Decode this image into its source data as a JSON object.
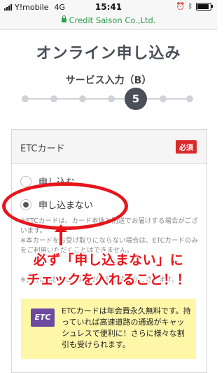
{
  "status_bar": {
    "carrier": "Y!mobile",
    "network": "4G",
    "time": "15:41",
    "battery_icon": "battery-icon",
    "bluetooth_icon": "bluetooth-icon"
  },
  "browser": {
    "url": "Credit Saison Co.,Ltd."
  },
  "page": {
    "title": "オンライン申し込み",
    "step_label": "サービス入力（B）",
    "current_step": "5",
    "steps_total": 7
  },
  "etc_card": {
    "title": "ETCカード",
    "required_badge": "必須",
    "options": [
      {
        "label": "申し込む",
        "selected": false
      },
      {
        "label": "申し込まない",
        "selected": true
      }
    ],
    "notes": [
      "※ETCカードは、カード本体と別送でお届けする場合がございます。",
      "※本カードをお受け取りにならない場合は、ETCカードのみをご利用いただくことはできません。",
      "※発行に追加のお手続きが必要な場合がございます。"
    ]
  },
  "annotation": {
    "line1": "必ず「申し込まない」に",
    "line2": "チェックを入れること！！",
    "color": "#e8141b"
  },
  "info": {
    "logo_text": "ETC",
    "text": "ETCカードは年会費永久無料です。持っていれば高速道路の通過がキャッシュレスで便利に！さらに様々な割引も受けられます。"
  }
}
